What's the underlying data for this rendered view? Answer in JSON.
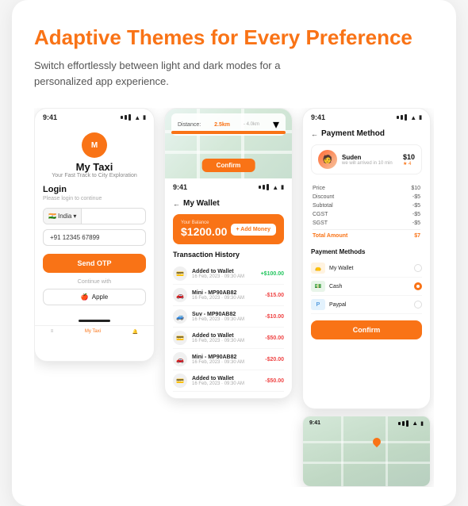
{
  "card": {
    "headline": "Adaptive Themes for Every Preference",
    "subtitle": "Switch effortlessly between light and dark modes for a personalized app experience."
  },
  "phone1": {
    "time": "9:41",
    "logo": "M",
    "app_title": "My Taxi",
    "tagline": "Your Fast Track to City Exploration",
    "login_heading": "Login",
    "login_sub": "Please login to continue",
    "flag_label": "India",
    "phone_number": "+91 12345 67899",
    "otp_btn": "Send OTP",
    "continue_with": "Continue with",
    "apple_label": "Apple",
    "nav_home": "≡",
    "nav_taxi": "My Taxi",
    "nav_bell": "🔔"
  },
  "phone2": {
    "time": "9:41",
    "distance_label": "Distance:",
    "distance_value": "2.5km",
    "distance_range": "- 4.0km",
    "confirm_label": "Confirm",
    "wallet_title": "My Wallet",
    "balance_label": "Your Balance",
    "balance_amount": "$1200.00",
    "add_money": "+ Add Money",
    "history_title": "Transaction History",
    "transactions": [
      {
        "icon": "💳",
        "name": "Added to Wallet",
        "date": "16 Feb, 2023 · 09:30 AM",
        "amount": "+$100.00",
        "type": "positive"
      },
      {
        "icon": "🚗",
        "name": "Mini - MP90AB82",
        "date": "16 Feb, 2023 · 09:30 AM",
        "amount": "-$15.00",
        "type": "negative"
      },
      {
        "icon": "🚙",
        "name": "Suv - MP90AB82",
        "date": "16 Feb, 2023 · 09:30 AM",
        "amount": "-$10.00",
        "type": "negative"
      },
      {
        "icon": "💳",
        "name": "Added to Wallet",
        "date": "16 Feb, 2023 · 09:30 AM",
        "amount": "-$50.00",
        "type": "negative"
      },
      {
        "icon": "🚗",
        "name": "Mini - MP90AB82",
        "date": "16 Feb, 2023 · 09:30 AM",
        "amount": "-$20.00",
        "type": "negative"
      },
      {
        "icon": "💳",
        "name": "Added to Wallet",
        "date": "16 Feb, 2023 · 09:30 AM",
        "amount": "-$50.00",
        "type": "negative"
      }
    ]
  },
  "phone3": {
    "time": "9:41",
    "title": "Payment Method",
    "driver_name": "Suden",
    "driver_sub": "we will arrived in 10 min",
    "driver_price": "$10",
    "driver_rating": "★ 4",
    "price_rows": [
      {
        "label": "Price",
        "value": "$10"
      },
      {
        "label": "Discount",
        "value": "-$5"
      },
      {
        "label": "Subtotal",
        "value": "-$5"
      },
      {
        "label": "CGST",
        "value": "-$5"
      },
      {
        "label": "SGST",
        "value": "-$5"
      },
      {
        "label": "Total Amount",
        "value": "$7",
        "total": true
      }
    ],
    "payment_methods_title": "Payment Methods",
    "methods": [
      {
        "icon": "👝",
        "type": "wallet",
        "name": "My Wallet",
        "selected": false
      },
      {
        "icon": "💵",
        "type": "cash",
        "name": "Cash",
        "selected": true
      },
      {
        "icon": "P",
        "type": "paypal",
        "name": "Paypal",
        "selected": false
      }
    ],
    "confirm_label": "Confirm"
  },
  "phone4": {
    "time": "9:41"
  },
  "colors": {
    "orange": "#F97316",
    "green": "#22c55e",
    "red": "#ef4444",
    "text_dark": "#111",
    "text_muted": "#888"
  }
}
